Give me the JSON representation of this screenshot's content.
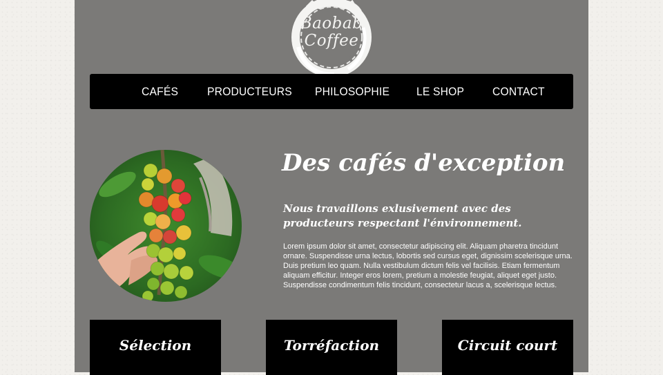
{
  "logo": {
    "line1": "Baobab",
    "line2": "Coffee"
  },
  "nav": {
    "items": [
      {
        "label": "CAFÉS"
      },
      {
        "label": "PRODUCTEURS"
      },
      {
        "label": "PHILOSOPHIE"
      },
      {
        "label": "LE SHOP"
      },
      {
        "label": "CONTACT"
      }
    ]
  },
  "hero": {
    "image": "coffee-cherries-branch-in-hand",
    "headline": "Des cafés d'exception",
    "subhead": "Nous travaillons exlusivement avec des producteurs respectant l'énvironnement.",
    "body": "Lorem ipsum dolor sit amet, consectetur adipiscing elit. Aliquam pharetra tincidunt ornare. Suspendisse urna lectus, lobortis sed cursus eget, dignissim scelerisque urna. Duis pretium leo quam. Nulla vestibulum dictum felis vel facilisis. Etiam fermentum aliquam efficitur. Integer eros lorem, pretium a molestie feugiat, aliquet eget justo. Suspendisse condimentum felis tincidunt, consectetur lacus a, scelerisque lectus."
  },
  "features": [
    {
      "label": "Sélection"
    },
    {
      "label": "Torréfaction"
    },
    {
      "label": "Circuit court"
    }
  ],
  "colors": {
    "page_background": "#f2f0ec",
    "content_background": "#7b7a78",
    "nav_background": "#000000",
    "text": "#ffffff"
  }
}
